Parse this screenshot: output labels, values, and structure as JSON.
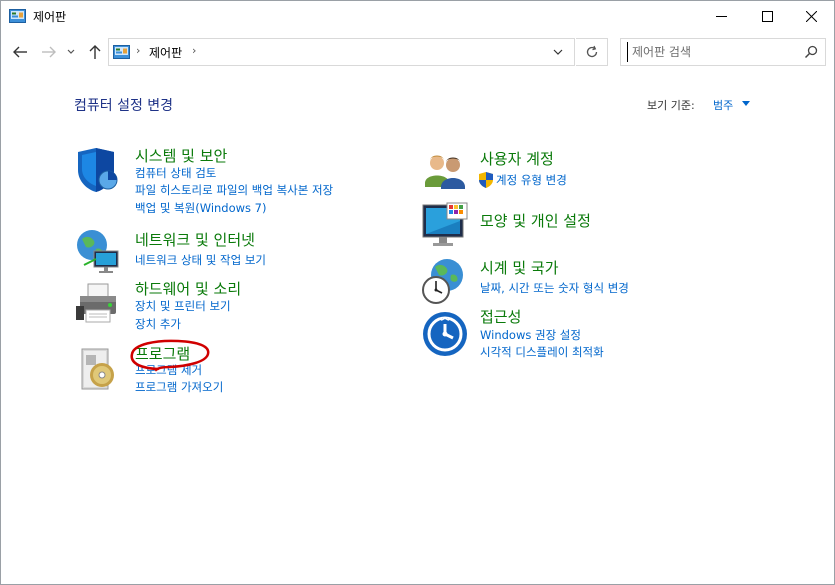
{
  "window": {
    "title": "제어판",
    "minimize_glyph": "—",
    "maximize_glyph": "☐",
    "close_glyph": "✕"
  },
  "nav": {
    "back_glyph": "←",
    "forward_glyph": "→",
    "recent_glyph": "⌄",
    "up_glyph": "↑",
    "breadcrumb_sep": "›",
    "breadcrumb": "제어판",
    "refresh_glyph": "↻"
  },
  "search": {
    "placeholder": "제어판 검색",
    "value": ""
  },
  "content": {
    "heading": "컴퓨터 설정 변경",
    "view_by_label": "보기 기준:",
    "view_by_value": "범주"
  },
  "categories_left": [
    {
      "icon": "shield-icon",
      "title": "시스템 및 보안",
      "links": [
        "컴퓨터 상태 검토",
        "파일 히스토리로 파일의 백업 복사본 저장",
        "백업 및 복원(Windows 7)"
      ]
    },
    {
      "icon": "network-globe-icon",
      "title": "네트워크 및 인터넷",
      "links": [
        "네트워크 상태 및 작업 보기"
      ]
    },
    {
      "icon": "printer-icon",
      "title": "하드웨어 및 소리",
      "links": [
        "장치 및 프린터 보기",
        "장치 추가"
      ]
    },
    {
      "icon": "programs-disc-icon",
      "title": "프로그램",
      "links": [
        "프로그램 제거",
        "프로그램 가져오기"
      ]
    }
  ],
  "categories_right": [
    {
      "icon": "users-icon",
      "title": "사용자 계정",
      "links": [
        "계정 유형 변경"
      ]
    },
    {
      "icon": "display-palette-icon",
      "title": "모양 및 개인 설정",
      "links": []
    },
    {
      "icon": "clock-globe-icon",
      "title": "시계 및 국가",
      "links": [
        "날짜, 시간 또는 숫자 형식 변경"
      ]
    },
    {
      "icon": "ease-of-access-icon",
      "title": "접근성",
      "links": [
        "Windows 권장 설정",
        "시각적 디스플레이 최적화"
      ]
    }
  ],
  "colors": {
    "category_title": "#0a7a0a",
    "link": "#0066cc",
    "heading": "#1e3287",
    "annotation": "#d00000"
  }
}
